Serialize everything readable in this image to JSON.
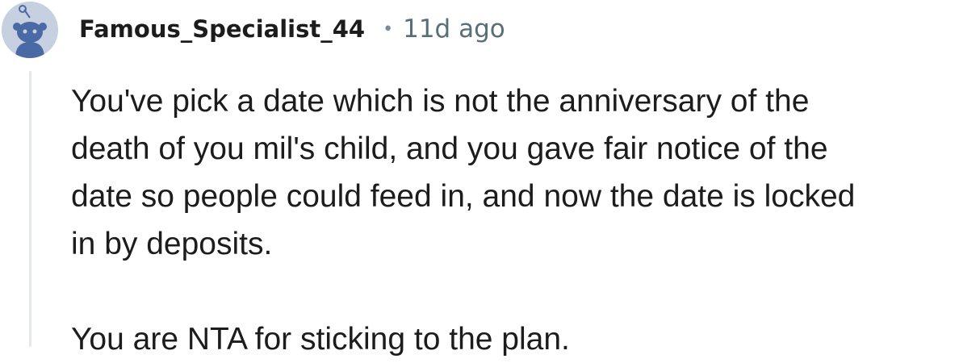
{
  "comment": {
    "author": "Famous_Specialist_44",
    "separator": "•",
    "timestamp": "11d ago",
    "avatar_icon": "reddit-snoo-avatar-icon",
    "body": {
      "paragraph1_lines": [
        "You've pick a date which is not the anniversary of the",
        "death of you mil's child, and you gave fair notice of the",
        "date so people could feed in, and now the date is locked",
        "in by deposits."
      ],
      "paragraph2": "You are NTA for sticking to the plan."
    }
  },
  "colors": {
    "avatar_bg": "#c7d0e0",
    "snoo": "#4a6aa5",
    "text": "#1c1c1c",
    "meta": "#576f76",
    "thread_line": "#e5e8ea"
  }
}
